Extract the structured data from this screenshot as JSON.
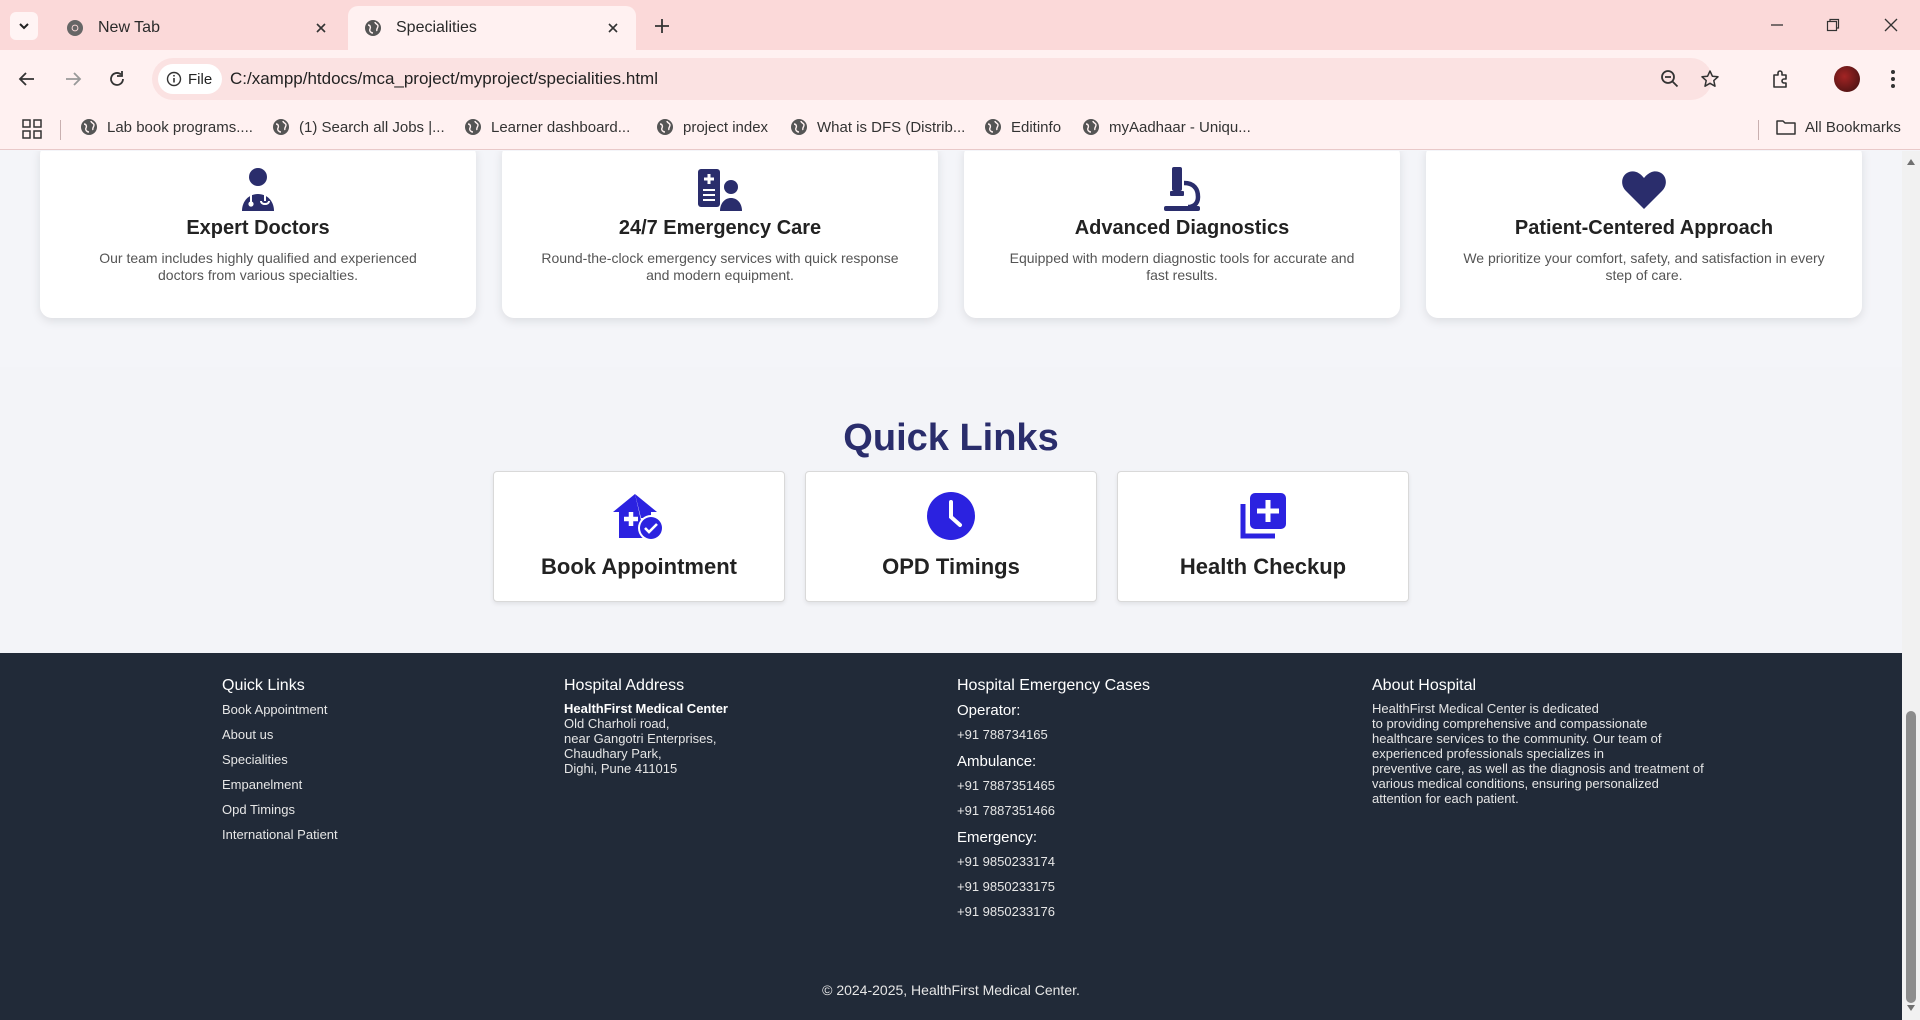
{
  "browser": {
    "tabs": [
      {
        "title": "New Tab",
        "active": false
      },
      {
        "title": "Specialities",
        "active": true
      }
    ],
    "address": {
      "chip_label": "File",
      "url": "C:/xampp/htdocs/mca_project/myproject/specialities.html"
    },
    "bookmarks": [
      "Lab book programs....",
      "(1) Search all Jobs |...",
      "Learner dashboard...",
      "project index",
      "What is DFS (Distrib...",
      "Editinfo",
      "myAadhaar - Uniqu..."
    ],
    "all_bookmarks_label": "All Bookmarks"
  },
  "features": [
    {
      "icon": "doctor-icon",
      "title": "Expert Doctors",
      "text": "Our team includes highly qualified and experienced doctors from various specialties."
    },
    {
      "icon": "hospital-user-icon",
      "title": "24/7 Emergency Care",
      "text": "Round-the-clock emergency services with quick response and modern equipment."
    },
    {
      "icon": "microscope-icon",
      "title": "Advanced Diagnostics",
      "text": "Equipped with modern diagnostic tools for accurate and fast results."
    },
    {
      "icon": "heart-icon",
      "title": "Patient-Centered Approach",
      "text": "We prioritize your comfort, safety, and satisfaction in every step of care."
    }
  ],
  "quick_links": {
    "title": "Quick Links",
    "items": [
      {
        "icon": "house-medical-check-icon",
        "label": "Book Appointment"
      },
      {
        "icon": "clock-icon",
        "label": "OPD Timings"
      },
      {
        "icon": "medical-copy-icon",
        "label": "Health Checkup"
      }
    ]
  },
  "footer": {
    "quick_links": {
      "heading": "Quick Links",
      "links": [
        "Book Appointment",
        "About us",
        "Specialities",
        "Empanelment",
        "Opd Timings",
        "International Patient"
      ]
    },
    "address": {
      "heading": "Hospital Address",
      "name": "HealthFirst Medical Center",
      "lines": [
        "Old Charholi road,",
        "near Gangotri Enterprises,",
        "Chaudhary Park,",
        "Dighi, Pune 411015"
      ]
    },
    "emergency": {
      "heading": "Hospital Emergency Cases",
      "operator_label": "Operator:",
      "operator": [
        "+91 788734165"
      ],
      "ambulance_label": "Ambulance:",
      "ambulance": [
        "+91 7887351465",
        "+91 7887351466"
      ],
      "emergency_label": "Emergency:",
      "emergency": [
        "+91 9850233174",
        "+91 9850233175",
        "+91 9850233176"
      ]
    },
    "about": {
      "heading": "About Hospital",
      "lines": [
        "HealthFirst Medical Center is dedicated",
        "to providing comprehensive and compassionate",
        "healthcare services to the community. Our team of",
        "experienced professionals specializes in",
        "preventive care, as well as the diagnosis and treatment of",
        "various medical conditions, ensuring personalized",
        "attention for each patient."
      ]
    },
    "copyright": "© 2024-2025, HealthFirst Medical Center."
  },
  "colors": {
    "feature_icon": "#2a2d6c",
    "quick_icon": "#2b22e0",
    "quick_title": "#2a2d6c",
    "footer_bg": "#212a38"
  }
}
